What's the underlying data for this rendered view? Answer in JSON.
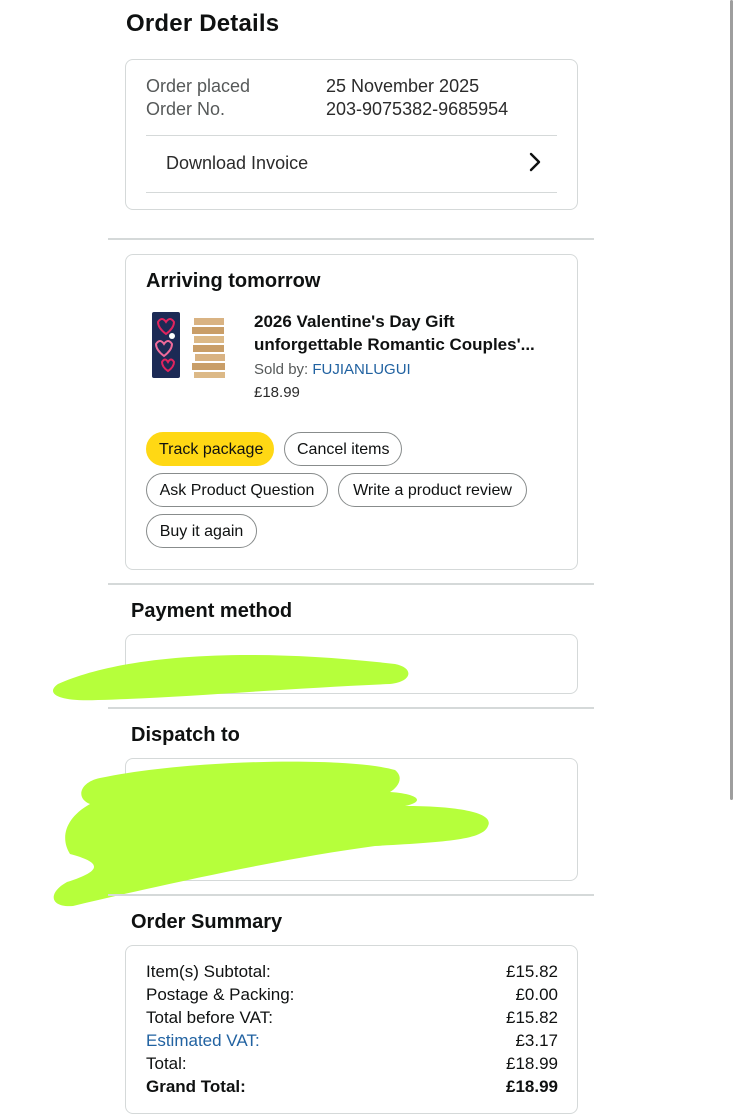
{
  "header": {
    "title": "Order Details"
  },
  "order_info": {
    "placed_label": "Order placed",
    "placed_value": "25 November 2025",
    "number_label": "Order No.",
    "number_value": "203-9075382-9685954",
    "invoice_label": "Download Invoice"
  },
  "shipment": {
    "status": "Arriving tomorrow",
    "product_title_line1": "2026 Valentine's Day Gift",
    "product_title_line2": "unforgettable Romantic Couples'...",
    "sold_by_label": "Sold by: ",
    "seller": "FUJIANLUGUI",
    "price": "£18.99",
    "buttons": {
      "track": "Track package",
      "cancel": "Cancel items",
      "ask": "Ask Product Question",
      "review": "Write a product review",
      "buy_again": "Buy it again"
    }
  },
  "payment": {
    "heading": "Payment method"
  },
  "dispatch": {
    "heading": "Dispatch to"
  },
  "summary": {
    "heading": "Order Summary",
    "rows": [
      {
        "label": "Item(s) Subtotal:",
        "value": "£15.82"
      },
      {
        "label": "Postage & Packing:",
        "value": "£0.00"
      },
      {
        "label": "Total before VAT:",
        "value": "£15.82"
      },
      {
        "label": "Estimated VAT:",
        "value": "£3.17"
      },
      {
        "label": "Total:",
        "value": "£18.99"
      },
      {
        "label": "Grand Total:",
        "value": "£18.99"
      }
    ]
  },
  "colors": {
    "accent_yellow": "#ffd814",
    "link_blue": "#2162a1",
    "redaction_green": "#b6ff3b",
    "border": "#d5d9d9"
  },
  "icons": [
    "chevron-right-icon",
    "product-thumbnail"
  ]
}
